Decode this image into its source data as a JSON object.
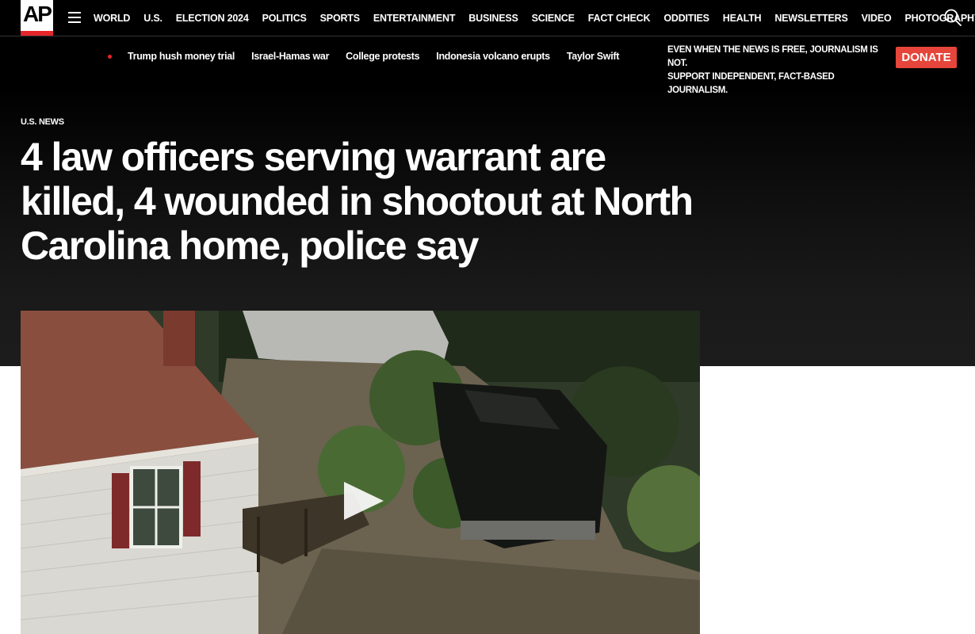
{
  "logo": "AP",
  "nav": {
    "items": [
      "WORLD",
      "U.S.",
      "ELECTION 2024",
      "POLITICS",
      "SPORTS",
      "ENTERTAINMENT",
      "BUSINESS",
      "SCIENCE",
      "FACT CHECK",
      "ODDITIES",
      "HEALTH",
      "NEWSLETTERS",
      "VIDEO",
      "PHOTOGRAPHY"
    ],
    "more": "···"
  },
  "trending": [
    "Trump hush money trial",
    "Israel-Hamas war",
    "College protests",
    "Indonesia volcano erupts",
    "Taylor Swift"
  ],
  "promo": {
    "line1": "EVEN WHEN THE NEWS IS FREE, JOURNALISM IS NOT.",
    "line2": "SUPPORT INDEPENDENT, FACT-BASED JOURNALISM."
  },
  "donate_label": "DONATE",
  "article": {
    "section": "U.S. NEWS",
    "headline": "4 law officers serving warrant are killed, 4 wounded in shootout at North Carolina home, police say"
  },
  "colors": {
    "accent_red": "#e5252a",
    "donate_bg": "#e5453a",
    "background_dark": "#000000"
  }
}
